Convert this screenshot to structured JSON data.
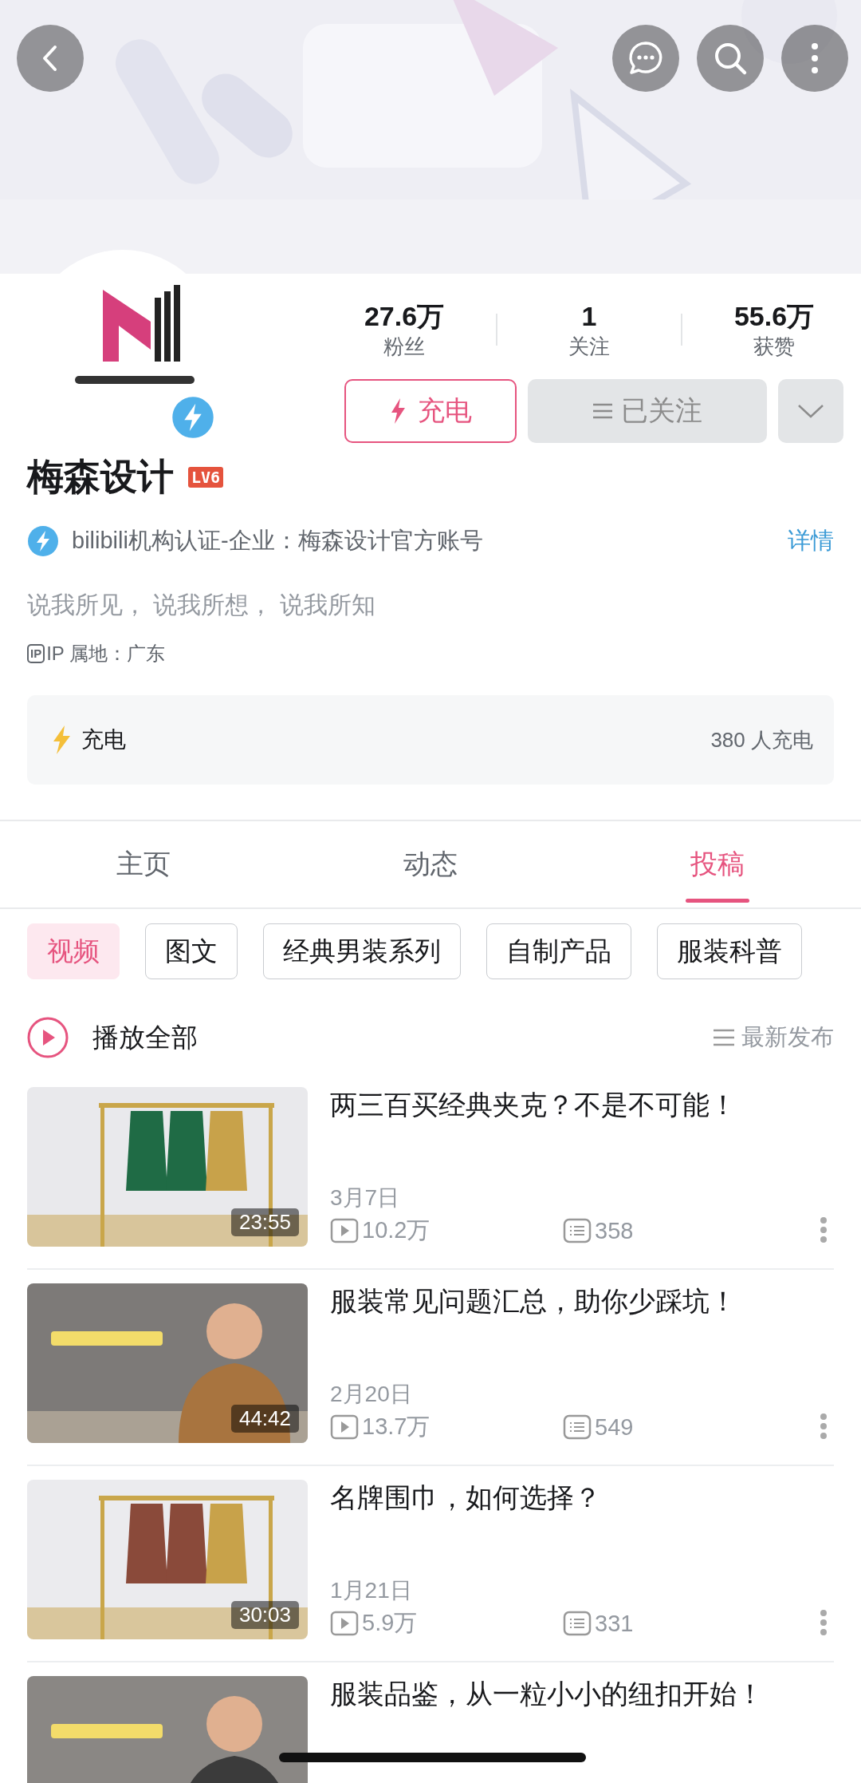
{
  "profile": {
    "stats": [
      {
        "value": "27.6万",
        "label": "粉丝"
      },
      {
        "value": "1",
        "label": "关注"
      },
      {
        "value": "55.6万",
        "label": "获赞"
      }
    ],
    "charge_button": "充电",
    "follow_button": "已关注",
    "name": "梅森设计",
    "level": "LV6",
    "verification": {
      "text": "bilibili机构认证-企业：梅森设计官方账号",
      "link": "详情"
    },
    "bio": "说我所见， 说我所想， 说我所知",
    "ip": {
      "badge": "IP",
      "text": "IP 属地：广东"
    }
  },
  "charge_card": {
    "label": "充电",
    "count": "380 人充电"
  },
  "tabs": [
    {
      "label": "主页",
      "selected": false
    },
    {
      "label": "动态",
      "selected": false
    },
    {
      "label": "投稿",
      "selected": true
    }
  ],
  "chips": [
    {
      "label": "视频",
      "selected": true
    },
    {
      "label": "图文",
      "selected": false
    },
    {
      "label": "经典男装系列",
      "selected": false
    },
    {
      "label": "自制产品",
      "selected": false
    },
    {
      "label": "服装科普",
      "selected": false
    }
  ],
  "play_all": "播放全部",
  "sort": "最新发布",
  "videos": [
    {
      "title": "两三百买经典夹克？不是不可能！",
      "duration": "23:55",
      "date": "3月7日",
      "views": "10.2万",
      "comments": "358"
    },
    {
      "title": "服装常见问题汇总，助你少踩坑！",
      "duration": "44:42",
      "date": "2月20日",
      "views": "13.7万",
      "comments": "549"
    },
    {
      "title": "名牌围巾，如何选择？",
      "duration": "30:03",
      "date": "1月21日",
      "views": "5.9万",
      "comments": "331"
    },
    {
      "title": "服装品鉴，从一粒小小的纽扣开始！"
    }
  ]
}
